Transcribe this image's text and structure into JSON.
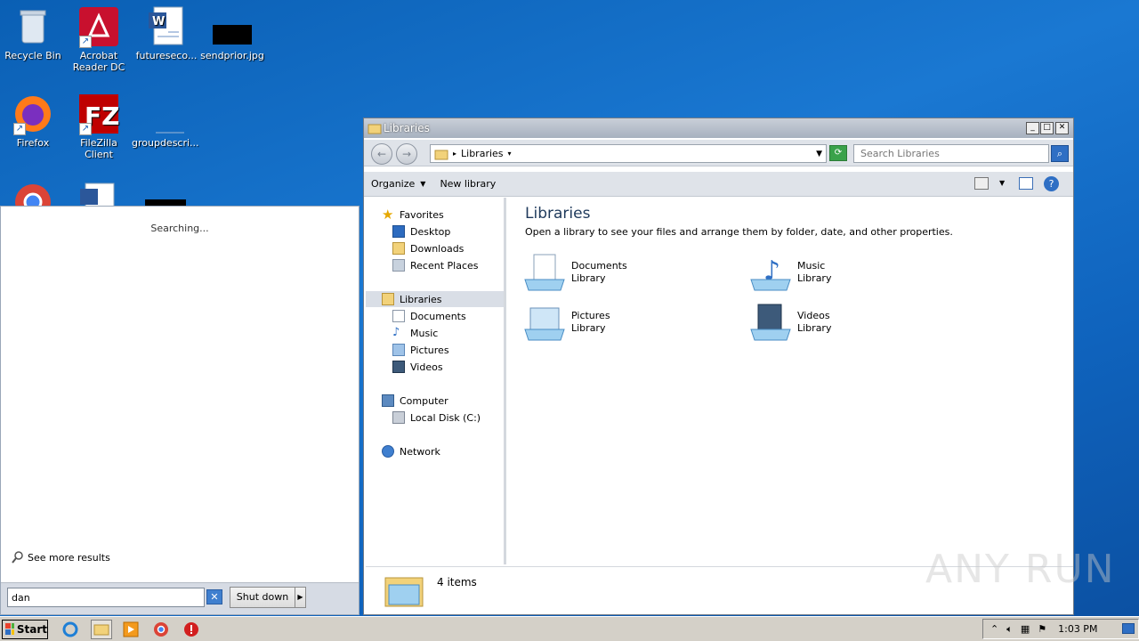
{
  "desktop": {
    "icons": [
      {
        "label": "Recycle Bin"
      },
      {
        "label": "Acrobat Reader DC"
      },
      {
        "label": "futureseco..."
      },
      {
        "label": "sendprior.jpg"
      },
      {
        "label": "Firefox"
      },
      {
        "label": "FileZilla Client"
      },
      {
        "label": "groupdescri..."
      }
    ]
  },
  "start_menu": {
    "status": "Searching...",
    "see_more": "See more results",
    "search_value": "dan",
    "shutdown_label": "Shut down"
  },
  "explorer": {
    "title": "Libraries",
    "address": "Libraries",
    "search_placeholder": "Search Libraries",
    "toolbar": {
      "organize": "Organize",
      "new_library": "New library"
    },
    "nav": {
      "favorites": "Favorites",
      "desktop": "Desktop",
      "downloads": "Downloads",
      "recent_places": "Recent Places",
      "libraries": "Libraries",
      "documents": "Documents",
      "music": "Music",
      "pictures": "Pictures",
      "videos": "Videos",
      "computer": "Computer",
      "local_disk": "Local Disk (C:)",
      "network": "Network"
    },
    "content": {
      "heading": "Libraries",
      "description": "Open a library to see your files and arrange them by folder, date, and other properties.",
      "libraries": [
        {
          "name": "Documents",
          "type": "Library"
        },
        {
          "name": "Music",
          "type": "Library"
        },
        {
          "name": "Pictures",
          "type": "Library"
        },
        {
          "name": "Videos",
          "type": "Library"
        }
      ]
    },
    "details": {
      "count": "4 items"
    }
  },
  "taskbar": {
    "start_label": "Start",
    "time": "1:03 PM"
  },
  "watermark": "ANY RUN"
}
